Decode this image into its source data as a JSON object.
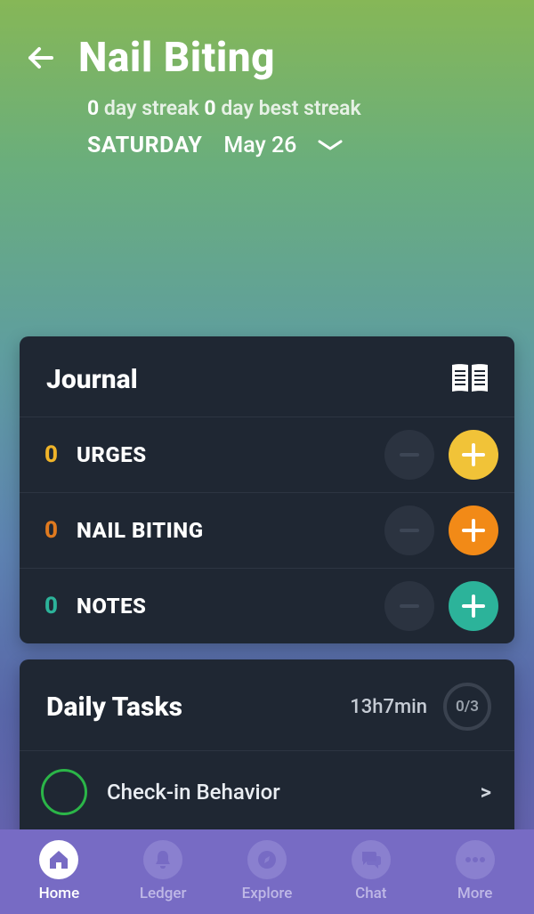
{
  "header": {
    "title": "Nail Biting",
    "streak_value": "0",
    "streak_label": " day streak ",
    "best_value": "0",
    "best_label": " day best streak",
    "date_day": "SATURDAY",
    "date_rest": "May 26"
  },
  "journal": {
    "title": "Journal",
    "rows": [
      {
        "count": "0",
        "label": "URGES",
        "count_class": "count-yellow",
        "plus_class": "plus-btn-yellow"
      },
      {
        "count": "0",
        "label": "NAIL BITING",
        "count_class": "count-orange",
        "plus_class": "plus-btn-orange"
      },
      {
        "count": "0",
        "label": "NOTES",
        "count_class": "count-teal",
        "plus_class": "plus-btn-teal"
      }
    ]
  },
  "daily": {
    "title": "Daily Tasks",
    "time": "13h7min",
    "progress": "0/3",
    "tasks": [
      {
        "label": "Check-in Behavior"
      }
    ]
  },
  "nav": {
    "items": [
      {
        "label": "Home",
        "active": true
      },
      {
        "label": "Ledger",
        "active": false
      },
      {
        "label": "Explore",
        "active": false
      },
      {
        "label": "Chat",
        "active": false
      },
      {
        "label": "More",
        "active": false
      }
    ]
  }
}
